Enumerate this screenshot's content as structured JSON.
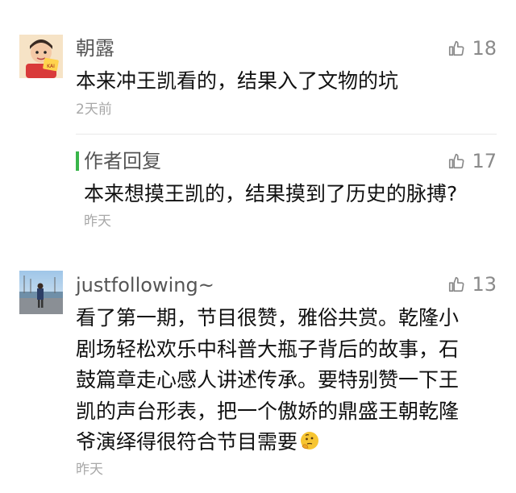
{
  "comments": [
    {
      "username": "朝露",
      "likes": "18",
      "text_lines": [
        "本来冲王凯看的，结果入了文物的坑"
      ],
      "time": "2天前",
      "avatar_badge": "KAI"
    },
    {
      "username": "justfollowing~",
      "likes": "13",
      "text_lines": [
        "看了第一期，节目很赞，雅俗共赏。乾隆小",
        "剧场轻松欢乐中科普大瓶子背后的故事，石",
        "鼓篇章走心感人讲述传承。要特别赞一下王",
        "凯的声台形表，把一个傲娇的鼎盛王朝乾隆",
        "爷演绎得很符合节目需要"
      ],
      "time": "昨天"
    }
  ],
  "author_reply": {
    "label": "作者回复",
    "likes": "17",
    "text": "本来想摸王凯的，结果摸到了历史的脉搏?",
    "time": "昨天"
  },
  "icons": {
    "like": "thumbs-up-outline-icon",
    "emoji": "thinking-face-emoji"
  },
  "colors": {
    "like_icon": "#8a8a8a",
    "reply_bar": "#39b54a",
    "username": "#555555",
    "timestamp": "#a8a8a8"
  }
}
